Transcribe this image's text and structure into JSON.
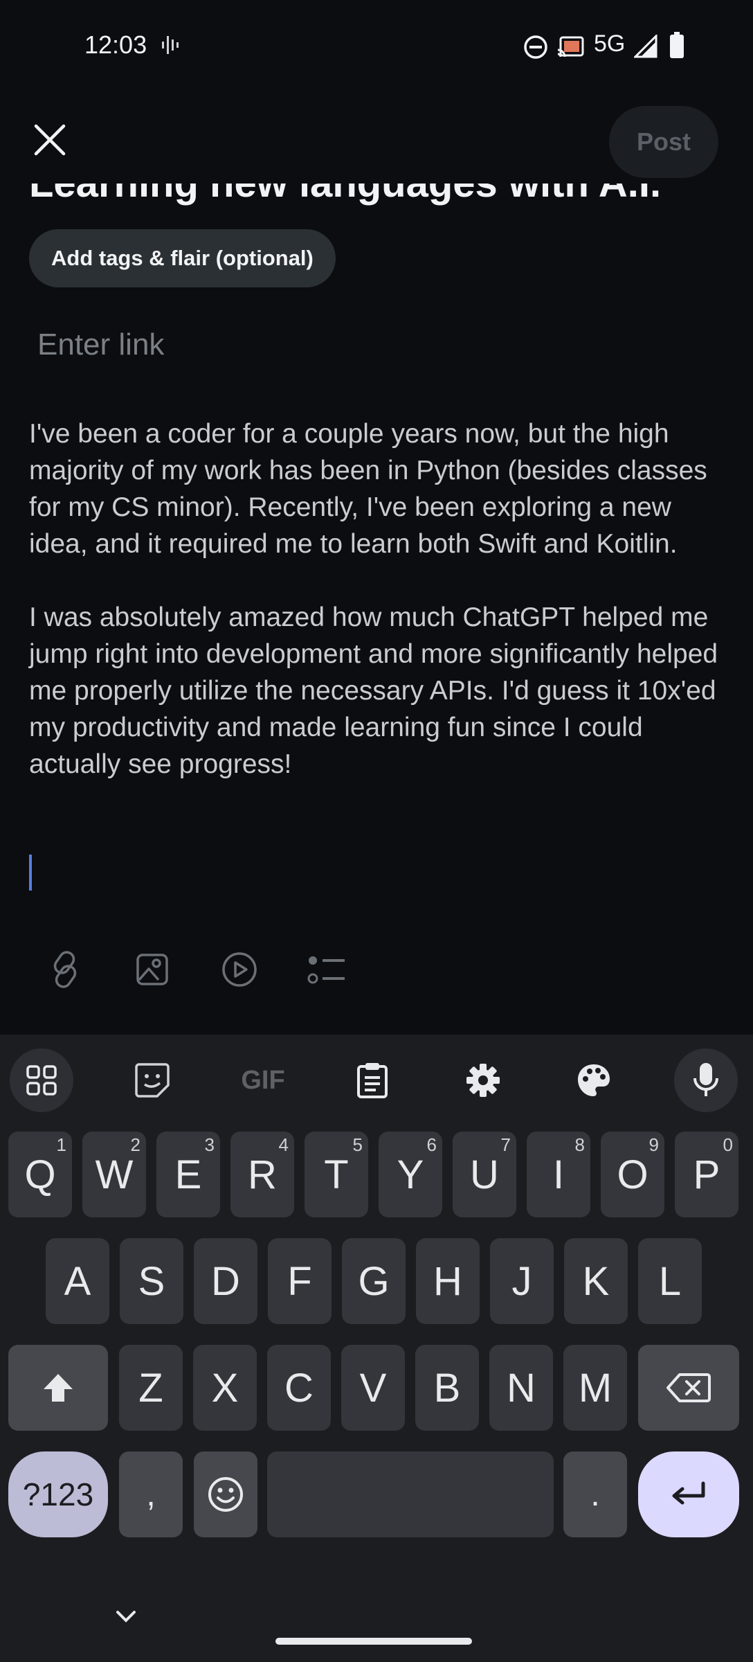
{
  "status_bar": {
    "time": "12:03",
    "network": "5G",
    "icons": [
      "voice-activity-icon",
      "do-not-disturb-icon",
      "cast-icon",
      "signal-icon",
      "battery-icon"
    ]
  },
  "header": {
    "close_icon": "close-icon",
    "post_label": "Post"
  },
  "post": {
    "title": "Learning new languages with A.I.",
    "tags_label": "Add tags & flair (optional)",
    "link_placeholder": "Enter link",
    "body_paragraph_1": "I've been a coder for a couple years now, but the high majority of my work has been in Python (besides classes for my CS minor). Recently, I've been exploring a new idea, and it required me to learn both Swift and Koitlin.",
    "body_paragraph_2": "I was absolutely amazed how much ChatGPT helped me jump right into development and more significantly helped me properly utilize the necessary APIs. I'd guess it 10x'ed my productivity and made learning fun since I could actually see progress!"
  },
  "format_bar": {
    "icons": [
      "link-icon",
      "image-icon",
      "video-icon",
      "list-icon"
    ]
  },
  "keyboard": {
    "toolbar": {
      "gif_label": "GIF",
      "icons": [
        "apps-grid-icon",
        "sticker-icon",
        "gif-icon",
        "clipboard-icon",
        "settings-icon",
        "palette-icon",
        "microphone-icon"
      ]
    },
    "row1": [
      {
        "key": "Q",
        "hint": "1"
      },
      {
        "key": "W",
        "hint": "2"
      },
      {
        "key": "E",
        "hint": "3"
      },
      {
        "key": "R",
        "hint": "4"
      },
      {
        "key": "T",
        "hint": "5"
      },
      {
        "key": "Y",
        "hint": "6"
      },
      {
        "key": "U",
        "hint": "7"
      },
      {
        "key": "I",
        "hint": "8"
      },
      {
        "key": "O",
        "hint": "9"
      },
      {
        "key": "P",
        "hint": "0"
      }
    ],
    "row2": [
      "A",
      "S",
      "D",
      "F",
      "G",
      "H",
      "J",
      "K",
      "L"
    ],
    "row3": [
      "Z",
      "X",
      "C",
      "V",
      "B",
      "N",
      "M"
    ],
    "symbols_label": "?123",
    "comma": ",",
    "period": ".",
    "accent_color": "#dcd9ff"
  }
}
